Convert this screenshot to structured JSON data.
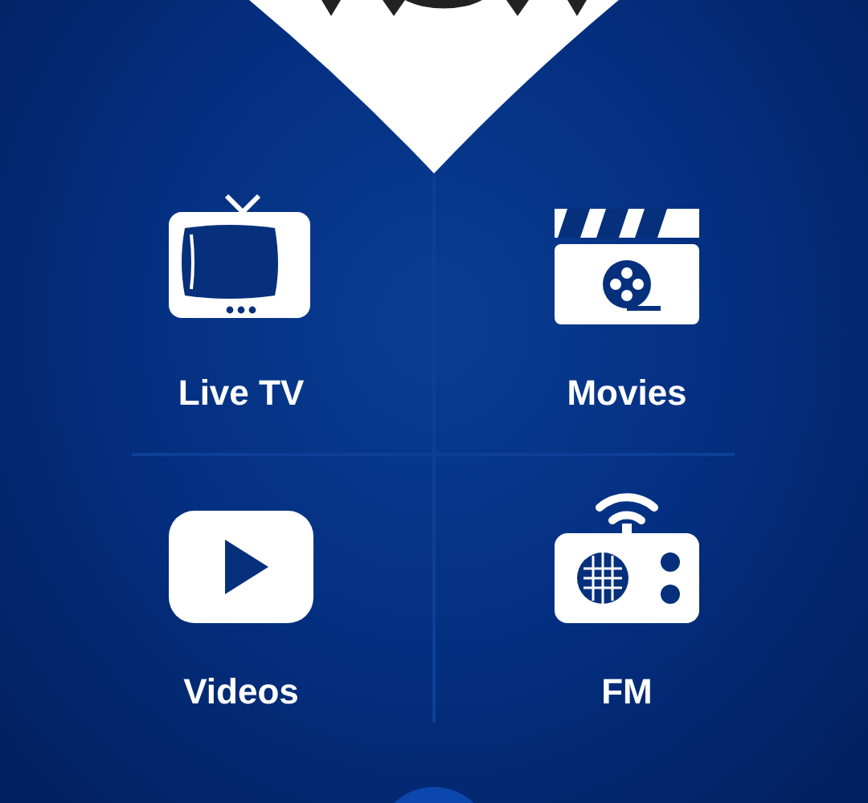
{
  "menu": [
    {
      "label": "Live TV",
      "kind": "tv"
    },
    {
      "label": "Movies",
      "kind": "movie"
    },
    {
      "label": "Videos",
      "kind": "play"
    },
    {
      "label": "FM",
      "kind": "radio"
    }
  ]
}
